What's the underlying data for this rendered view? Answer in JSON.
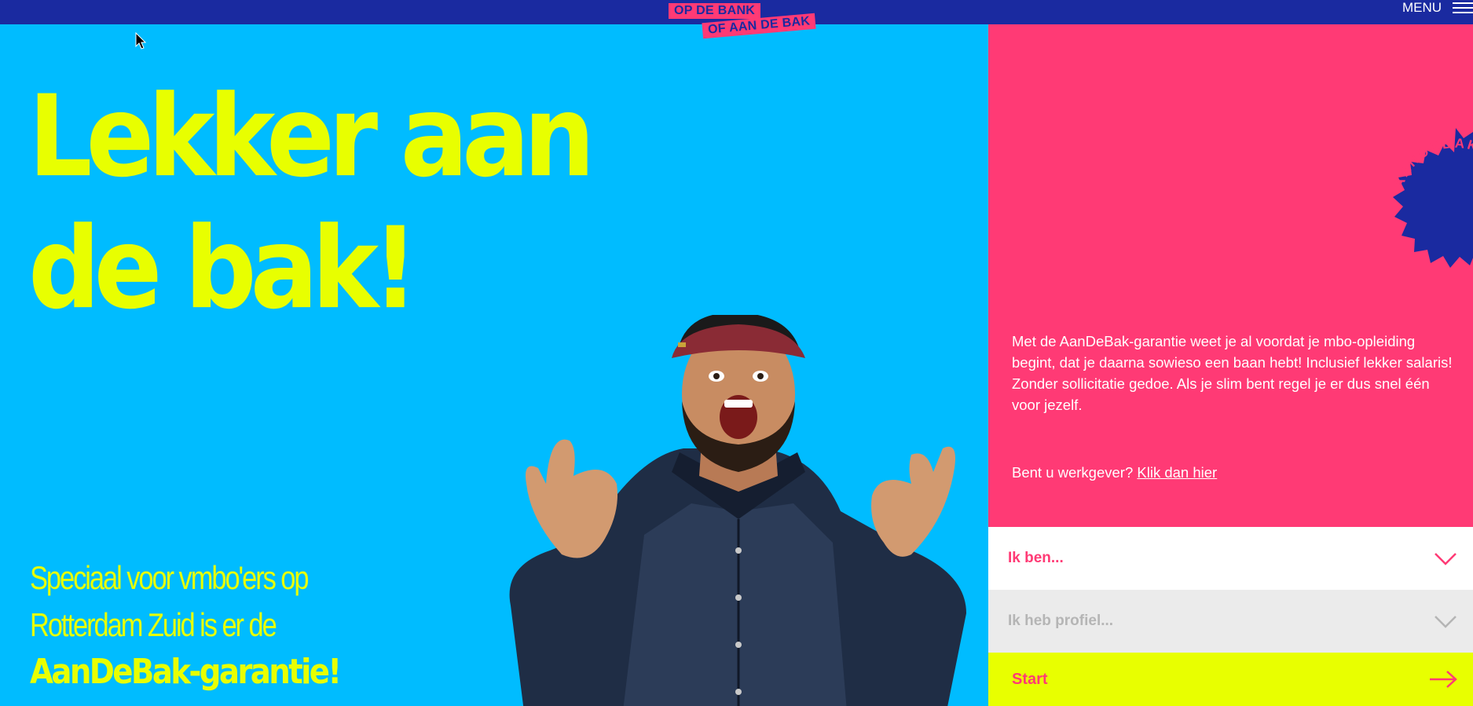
{
  "header": {
    "logo_line1": "OP DE BANK",
    "logo_line2": "OF AAN DE BAK",
    "menu_label": "MENU",
    "menu_icon": "hamburger-icon"
  },
  "hero": {
    "headline_line1": "Lekker aan",
    "headline_line2": "de bak!",
    "sub_line1": "Speciaal voor vmbo'ers op",
    "sub_line2": "Rotterdam Zuid is er de",
    "sub_line3": "AanDeBak-garantie!"
  },
  "side_panel": {
    "seal_text": "AANDEBAK·GARANTIE",
    "intro": "Met de AanDeBak-garantie weet je al voordat je mbo-opleiding begint, dat je daarna sowieso een baan hebt! Inclusief lekker salaris! Zonder sollicitatie gedoe. Als je slim bent regel je er dus snel één voor jezelf.",
    "employer_prefix": "Bent u werkgever?",
    "employer_link": "Klik dan hier"
  },
  "form": {
    "select1_label": "Ik ben...",
    "select2_label": "Ik heb profiel...",
    "start_label": "Start"
  },
  "colors": {
    "navy": "#1a2aa0",
    "sky": "#00bcff",
    "pink": "#ff3a75",
    "lime": "#e8ff00",
    "grey": "#ebebeb"
  }
}
